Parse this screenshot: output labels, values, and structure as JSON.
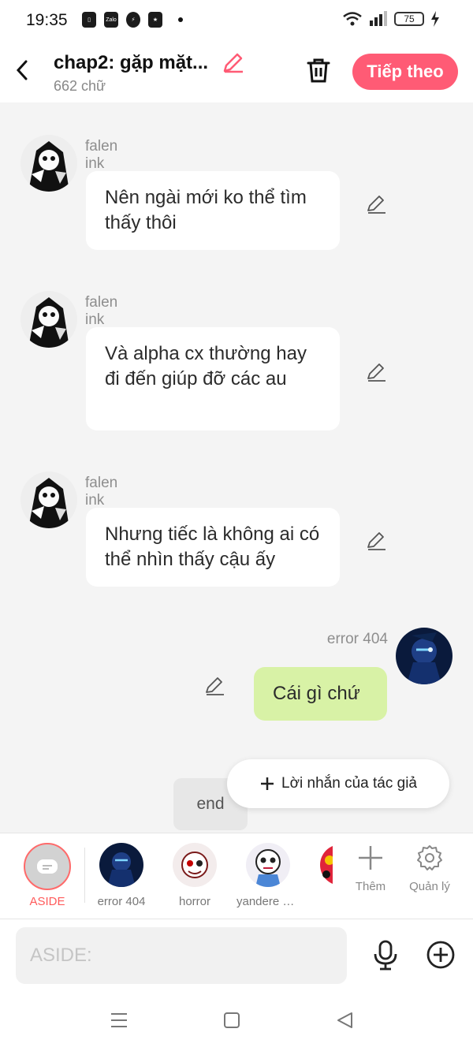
{
  "status_bar": {
    "time": "19:35",
    "battery": "75",
    "notif_icons": [
      "phone-icon",
      "zalo-icon",
      "messenger-icon",
      "star-icon"
    ]
  },
  "header": {
    "title": "chap2: gặp mặt...",
    "word_count": "662 chữ",
    "next_label": "Tiếp theo"
  },
  "messages": [
    {
      "sender": "falen ink",
      "text": "Nên ngài mới ko thể tìm thấy thôi",
      "side": "left"
    },
    {
      "sender": "falen ink",
      "text": "Và alpha cx thường hay đi đến giúp đỡ các au",
      "side": "left"
    },
    {
      "sender": "falen ink",
      "text": "Nhưng tiếc là không ai có thể nhìn thấy cậu ấy",
      "side": "left"
    },
    {
      "sender": "error 404",
      "text": "Cái gì chứ",
      "side": "right"
    }
  ],
  "end_label": "end",
  "author_note_label": "Lời nhắn của tác giả",
  "character_bar": {
    "aside_label": "ASIDE",
    "characters": [
      "error 404",
      "horror",
      "yandere bl..."
    ],
    "add_label": "Thêm",
    "manage_label": "Quản lý"
  },
  "composer": {
    "placeholder": "ASIDE:"
  },
  "colors": {
    "accent": "#ff5b75",
    "my_bubble": "#d8f2a6",
    "background": "#f4f4f4"
  }
}
